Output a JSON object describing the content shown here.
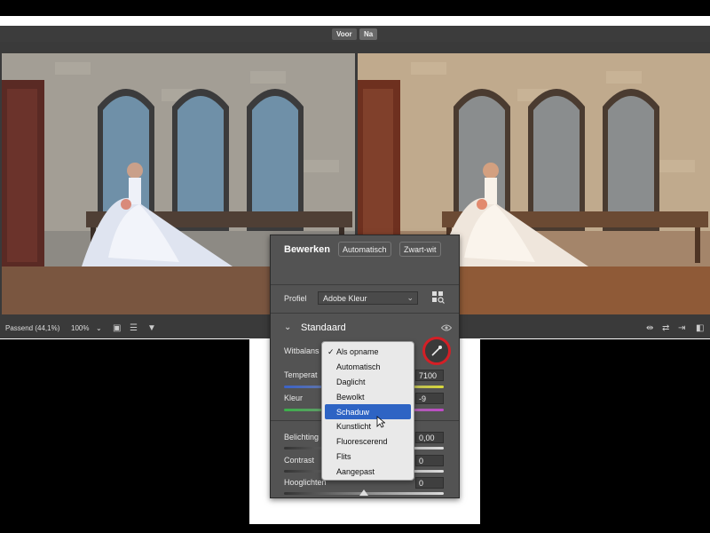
{
  "compare": {
    "before_label": "Voor",
    "after_label": "Na"
  },
  "bottombar": {
    "zoom_label": "Passend (44,1%)",
    "zoom_value": "100%",
    "zoom_chevron": "⌄"
  },
  "panel": {
    "title": "Bewerken",
    "auto_button": "Automatisch",
    "bw_button": "Zwart-wit",
    "profile_label": "Profiel",
    "profile_value": "Adobe Kleur",
    "section_title": "Standaard",
    "whitebalance_label": "Witbalans",
    "temperature_label": "Temperat",
    "temperature_value": "7100",
    "tint_label": "Kleur",
    "tint_value": "-9",
    "exposure_label": "Belichting",
    "exposure_value": "0,00",
    "contrast_label": "Contrast",
    "contrast_value": "0",
    "highlights_label": "Hooglichten",
    "highlights_value": "0"
  },
  "whitebalance_menu": {
    "checked_item": "Als opname",
    "highlighted_item": "Schaduw",
    "items": [
      "Als opname",
      "Automatisch",
      "Daglicht",
      "Bewolkt",
      "Schaduw",
      "Kunstlicht",
      "Fluorescerend",
      "Flits",
      "Aangepast"
    ]
  },
  "icons": {
    "eyedropper": "eyedropper-icon",
    "profile_browser": "grid-search-icon",
    "visibility": "eye-icon",
    "section_toggle": "chevron-down-icon"
  },
  "colors": {
    "highlight": "#d41f26",
    "selection": "#2e64c4",
    "panel_bg": "#535353"
  }
}
